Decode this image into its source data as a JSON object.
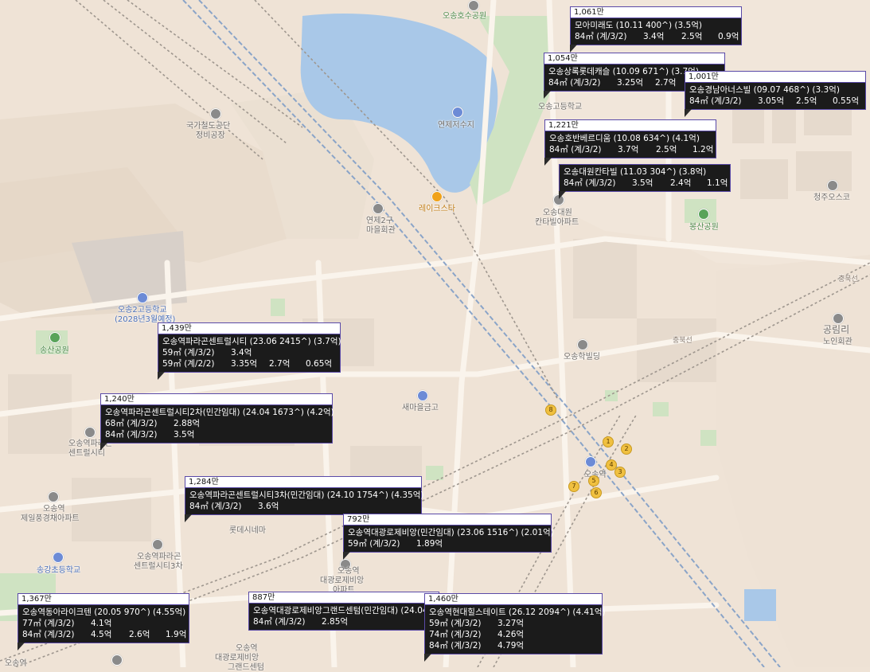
{
  "colors": {
    "land": "#efe3d6",
    "lake": "#a9c8e8",
    "park": "#cfe3c2",
    "rail": "#8aa4c8",
    "card_bg": "#1b1b1b",
    "card_border": "#5a4aa8",
    "road": "#f8f2ea"
  },
  "map_labels": [
    {
      "id": "osong-lake-park",
      "text": "오송호수공원",
      "type": "park"
    },
    {
      "id": "gukga",
      "text": "국가철도공단",
      "type": "place"
    },
    {
      "id": "jeongbi",
      "text": "정비공장",
      "type": "place"
    },
    {
      "id": "yeonje-reservoir",
      "text": "연제저수지",
      "type": "place"
    },
    {
      "id": "lakestar",
      "text": "레이크스타",
      "type": "poi"
    },
    {
      "id": "yeonje2gu",
      "text": "연제2구",
      "type": "place"
    },
    {
      "id": "maeul",
      "text": "마을회관",
      "type": "place"
    },
    {
      "id": "osong-high",
      "text": "오송고등학교",
      "type": "place"
    },
    {
      "id": "cheongju-outlet",
      "text": "청주오스코",
      "type": "place"
    },
    {
      "id": "bongsan-park",
      "text": "봉산공원",
      "type": "park"
    },
    {
      "id": "osong-daewon",
      "text": "오송대원",
      "type": "place"
    },
    {
      "id": "kantavil",
      "text": "칸타빌아파트",
      "type": "place"
    },
    {
      "id": "osong2-school",
      "text": "오송2고등학교",
      "type": "place"
    },
    {
      "id": "school-2028",
      "text": "(2028년3월예정)",
      "type": "place"
    },
    {
      "id": "songsan-park",
      "text": "송산공원",
      "type": "park"
    },
    {
      "id": "osong-hakbit",
      "text": "오송학빌딩",
      "type": "place"
    },
    {
      "id": "saemaeul",
      "text": "새마을금고",
      "type": "place"
    },
    {
      "id": "gongnyeong",
      "text": "공림리",
      "type": "place"
    },
    {
      "id": "noin",
      "text": "노인회관",
      "type": "place"
    },
    {
      "id": "osong-parago",
      "text": "오송역파라곤",
      "type": "place"
    },
    {
      "id": "central",
      "text": "센트럴시티",
      "type": "place"
    },
    {
      "id": "lotte-cinema",
      "text": "롯데시네마",
      "type": "place"
    },
    {
      "id": "osong-station-label",
      "text": "오송역",
      "type": "place"
    },
    {
      "id": "jeil-apt",
      "text": "제일풍경채아파트",
      "type": "place"
    },
    {
      "id": "songgang-school",
      "text": "송강초등학교",
      "type": "place"
    },
    {
      "id": "parago3",
      "text": "오송역파라곤",
      "type": "place"
    },
    {
      "id": "central3",
      "text": "센트럴시티3차",
      "type": "place"
    },
    {
      "id": "osong-station-2",
      "text": "오송역",
      "type": "place"
    },
    {
      "id": "daegwang",
      "text": "대광로제비앙",
      "type": "place"
    },
    {
      "id": "apt",
      "text": "아파트",
      "type": "place"
    },
    {
      "id": "osong-station-3",
      "text": "오송역",
      "type": "place"
    },
    {
      "id": "daegwang2",
      "text": "대광로제비앙",
      "type": "place"
    },
    {
      "id": "grand",
      "text": "그랜드센텀",
      "type": "place"
    },
    {
      "id": "station-bottom",
      "text": "오송역",
      "type": "place"
    },
    {
      "id": "chungbuk",
      "text": "충북선",
      "type": "road"
    },
    {
      "id": "chungbuk2",
      "text": "충북선",
      "type": "road"
    },
    {
      "id": "osong-bulk",
      "text": "오송역",
      "type": "place"
    },
    {
      "id": "osong-station-main",
      "text": "오송역",
      "type": "place"
    }
  ],
  "listings": [
    {
      "price": "1,061만",
      "title": "모아미래도 (10.11 400^) (3.5억)",
      "rows": [
        [
          "84㎡ (계/3/2)",
          "3.4억",
          "2.5억",
          "0.9억"
        ]
      ]
    },
    {
      "price": "1,054만",
      "title": "오송상록롯데캐슬 (10.09 671^) (3.7억)",
      "rows": [
        [
          "84㎡ (계/3/2)",
          "3.25억",
          "2.7억",
          ""
        ]
      ]
    },
    {
      "price": "1,001만",
      "title": "오송경남아너스빌 (09.07 468^) (3.3억)",
      "rows": [
        [
          "84㎡ (계/3/2)",
          "3.05억",
          "2.5억",
          "0.55억"
        ]
      ]
    },
    {
      "price": "1,221만",
      "title": "오송호반베르디움 (10.08 634^) (4.1억)",
      "rows": [
        [
          "84㎡ (계/3/2)",
          "3.7억",
          "2.5억",
          "1.2억"
        ]
      ]
    },
    {
      "price": "",
      "title": "오송대원칸타빌 (11.03 304^) (3.8억)",
      "rows": [
        [
          "84㎡ (계/3/2)",
          "3.5억",
          "2.4억",
          "1.1억"
        ]
      ]
    },
    {
      "price": "1,439만",
      "title": "오송역파라곤센트럴시티 (23.06 2415^) (3.7억)",
      "rows": [
        [
          "59㎡ (계/3/2)",
          "3.4억",
          "",
          ""
        ],
        [
          "59㎡ (계/2/2)",
          "3.35억",
          "2.7억",
          "0.65억"
        ]
      ]
    },
    {
      "price": "1,240만",
      "title": "오송역파라곤센트럴시티2차(민간임대) (24.04 1673^) (4.2억)",
      "rows": [
        [
          "68㎡ (계/3/2)",
          "2.88억",
          "",
          ""
        ],
        [
          "84㎡ (계/3/2)",
          "3.5억",
          "",
          ""
        ]
      ]
    },
    {
      "price": "1,284만",
      "title": "오송역파라곤센트럴시티3차(민간임대) (24.10 1754^) (4.35억)",
      "rows": [
        [
          "84㎡ (계/3/2)",
          "3.6억",
          "",
          ""
        ]
      ]
    },
    {
      "price": "792만",
      "title": "오송역대광로제비앙(민간임대) (23.06 1516^) (2.01억)",
      "rows": [
        [
          "59㎡ (계/3/2)",
          "1.89억",
          "",
          ""
        ]
      ]
    },
    {
      "price": "1,367만",
      "title": "오송역동아라이크텐 (20.05 970^) (4.55억)",
      "rows": [
        [
          "77㎡ (계/3/2)",
          "4.1억",
          "",
          ""
        ],
        [
          "84㎡ (계/3/2)",
          "4.5억",
          "2.6억",
          "1.9억"
        ]
      ]
    },
    {
      "price": "887만",
      "title": "오송역대광로제비앙그랜드센텀(민간임대) (24.04",
      "rows": [
        [
          "84㎡ (계/3/2)",
          "2.85억",
          "",
          ""
        ]
      ]
    },
    {
      "price": "1,460만",
      "title": "오송역현대힐스테이트 (26.12 2094^) (4.41억)",
      "rows": [
        [
          "59㎡ (계/3/2)",
          "3.27억",
          "",
          ""
        ],
        [
          "74㎡ (계/3/2)",
          "4.26억",
          "",
          ""
        ],
        [
          "84㎡ (계/3/2)",
          "4.79억",
          "",
          ""
        ]
      ]
    }
  ],
  "station_exits": [
    "1",
    "2",
    "3",
    "4",
    "5",
    "6",
    "7",
    "8"
  ]
}
